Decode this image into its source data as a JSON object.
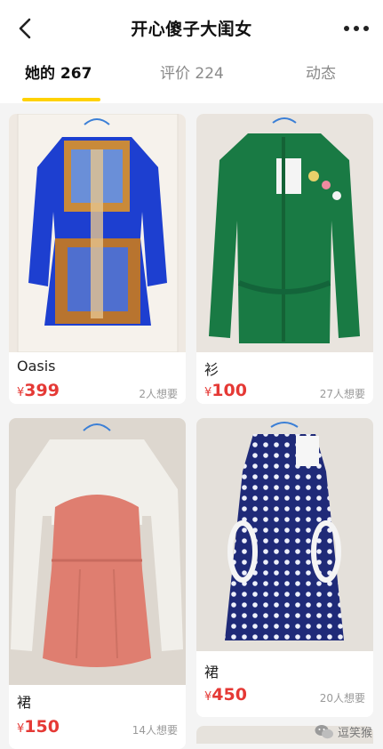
{
  "header": {
    "title": "开心傻子大闺女",
    "back_icon": "chevron-left-icon",
    "more_icon": "more-horizontal-icon"
  },
  "tabs": [
    {
      "label": "她的 267",
      "active": true
    },
    {
      "label": "评价 224",
      "active": false
    },
    {
      "label": "动态",
      "active": false
    }
  ],
  "colors": {
    "accent": "#ffd200",
    "price": "#e53935"
  },
  "items": [
    {
      "title": "Oasis",
      "currency": "¥",
      "price": "399",
      "wants": "2人想要"
    },
    {
      "title": "衫",
      "currency": "¥",
      "price": "100",
      "wants": "27人想要"
    },
    {
      "title": "裙",
      "currency": "¥",
      "price": "150",
      "wants": "14人想要"
    },
    {
      "title": "裙",
      "currency": "¥",
      "price": "450",
      "wants": "20人想要"
    }
  ],
  "watermark": {
    "text": "逗笑猴",
    "icon": "wechat-icon"
  }
}
